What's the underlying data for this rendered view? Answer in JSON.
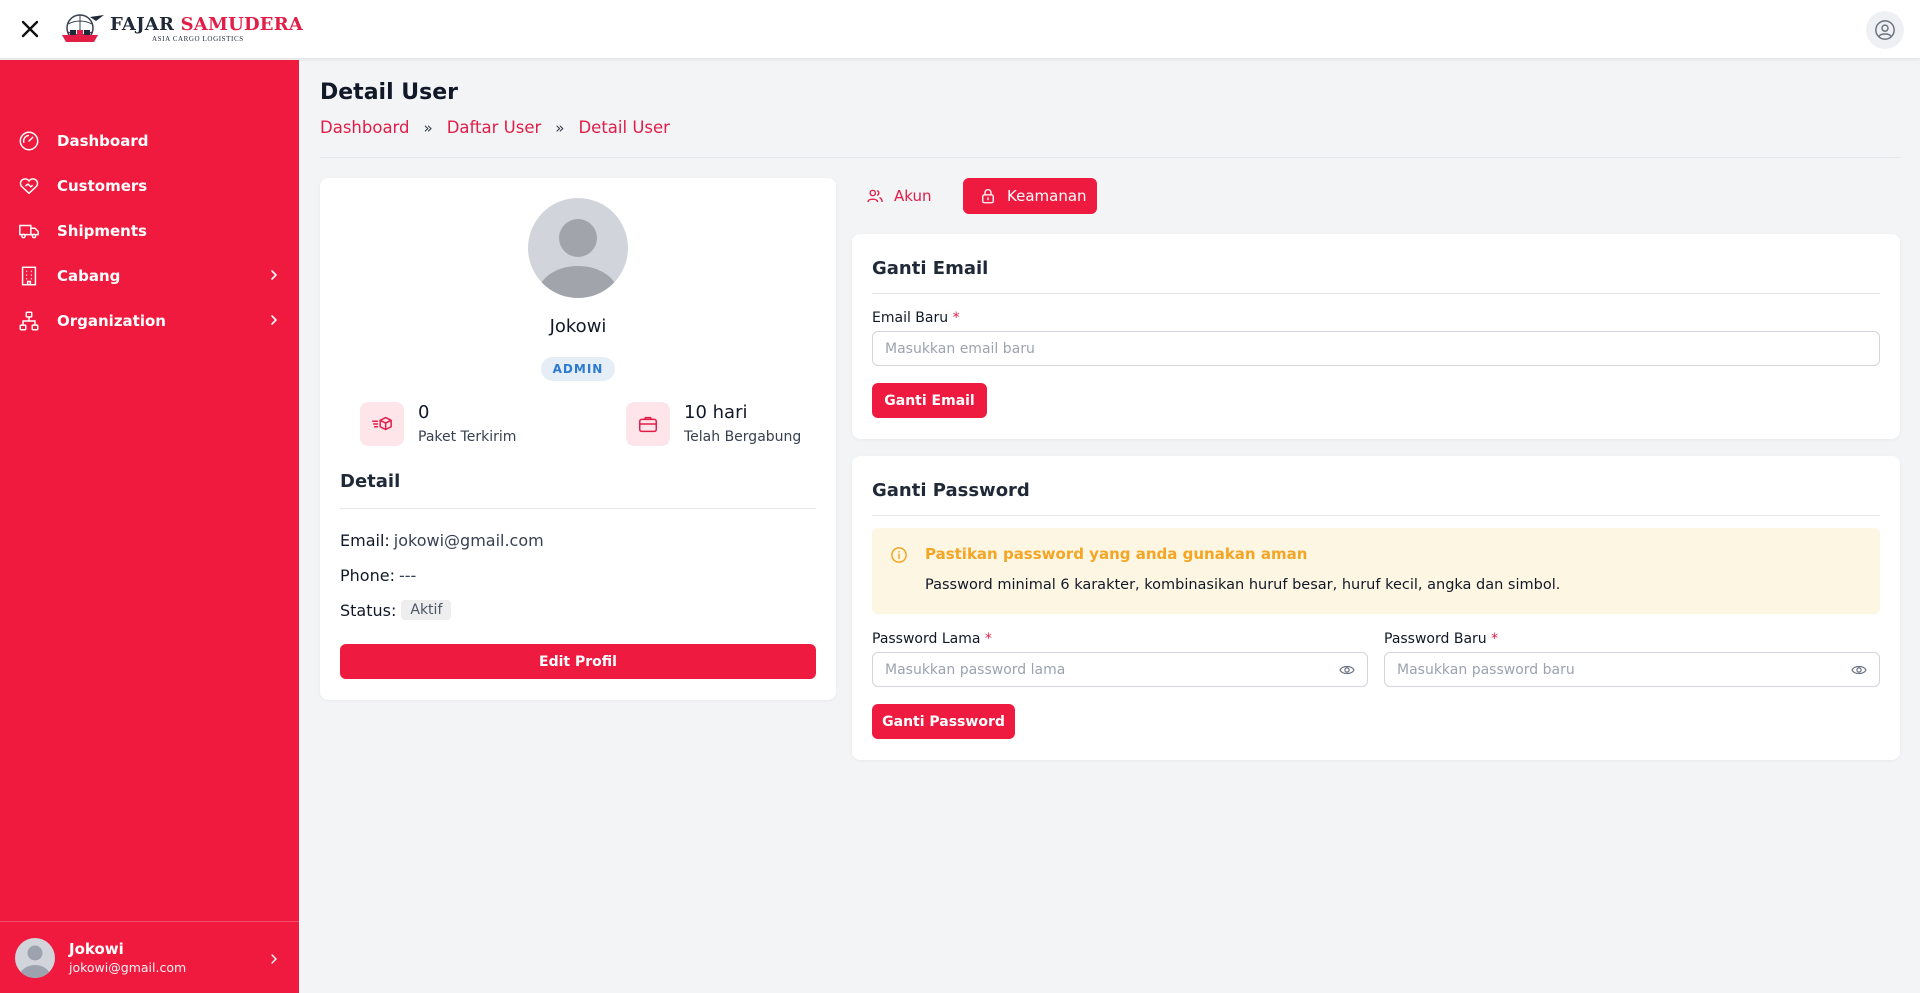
{
  "header": {
    "logo_title_part1": "FAJAR",
    "logo_title_part2": "SAMUDERA",
    "logo_subtitle": "ASIA CARGO LOGISTICS"
  },
  "sidebar": {
    "items": [
      {
        "label": "Dashboard",
        "icon": "gauge-icon"
      },
      {
        "label": "Customers",
        "icon": "handshake-heart-icon"
      },
      {
        "label": "Shipments",
        "icon": "truck-icon"
      },
      {
        "label": "Cabang",
        "icon": "building-icon",
        "has_submenu": true
      },
      {
        "label": "Organization",
        "icon": "org-chart-icon",
        "has_submenu": true
      }
    ],
    "user": {
      "name": "Jokowi",
      "email": "jokowi@gmail.com"
    }
  },
  "page": {
    "title": "Detail User",
    "breadcrumb": [
      "Dashboard",
      "Daftar User",
      "Detail User"
    ]
  },
  "profile": {
    "name": "Jokowi",
    "role": "ADMIN",
    "stats": [
      {
        "value": "0",
        "label": "Paket Terkirim",
        "icon": "fast-package-icon"
      },
      {
        "value": "10 hari",
        "label": "Telah Bergabung",
        "icon": "briefcase-icon"
      }
    ],
    "detail_title": "Detail",
    "email_label": "Email:",
    "email_value": "jokowi@gmail.com",
    "phone_label": "Phone:",
    "phone_value": "---",
    "status_label": "Status:",
    "status_value": "Aktif",
    "edit_button": "Edit Profil"
  },
  "tabs": [
    {
      "label": "Akun",
      "icon": "users-icon",
      "active": false
    },
    {
      "label": "Keamanan",
      "icon": "lock-icon",
      "active": true
    }
  ],
  "email_form": {
    "title": "Ganti Email",
    "label": "Email Baru",
    "required_mark": "*",
    "placeholder": "Masukkan email baru",
    "button": "Ganti Email"
  },
  "password_form": {
    "title": "Ganti Password",
    "alert_title": "Pastikan password yang anda gunakan aman",
    "alert_body": "Password minimal 6 karakter, kombinasikan huruf besar, huruf kecil, angka dan simbol.",
    "old_label": "Password Lama",
    "old_placeholder": "Masukkan password lama",
    "new_label": "Password Baru",
    "new_placeholder": "Masukkan password baru",
    "required_mark": "*",
    "button": "Ganti Password"
  },
  "colors": {
    "brand": "#ef1a3e",
    "warning": "#f5a524",
    "role_badge": "#2b7bd3"
  }
}
